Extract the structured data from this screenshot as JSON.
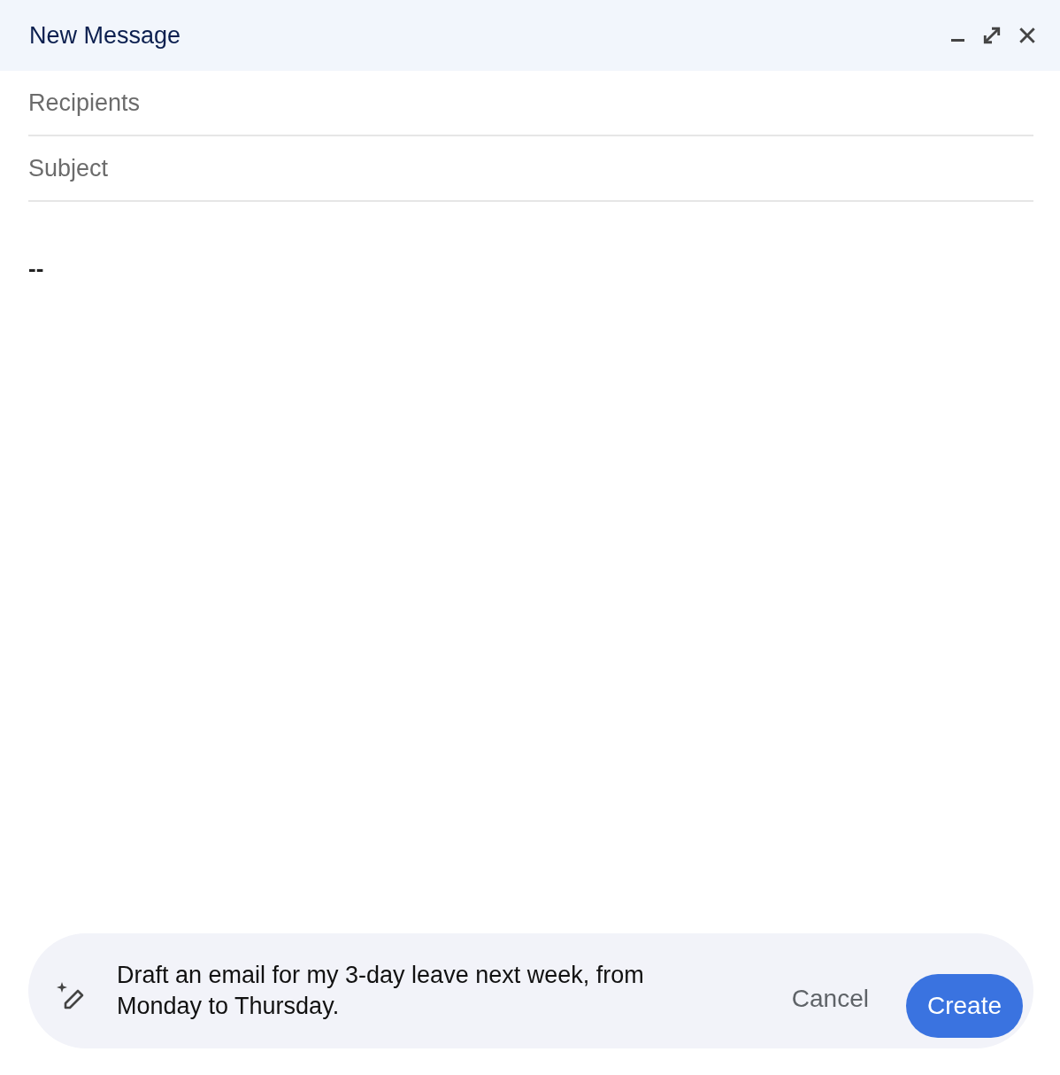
{
  "window": {
    "title": "New Message"
  },
  "fields": [
    {
      "placeholder": "Recipients"
    },
    {
      "placeholder": "Subject"
    }
  ],
  "body": {
    "signature": "--"
  },
  "prompt": {
    "value": "Draft an email for my 3-day leave next week, from Monday to Thursday.",
    "cancel": "Cancel",
    "create": "Create"
  }
}
